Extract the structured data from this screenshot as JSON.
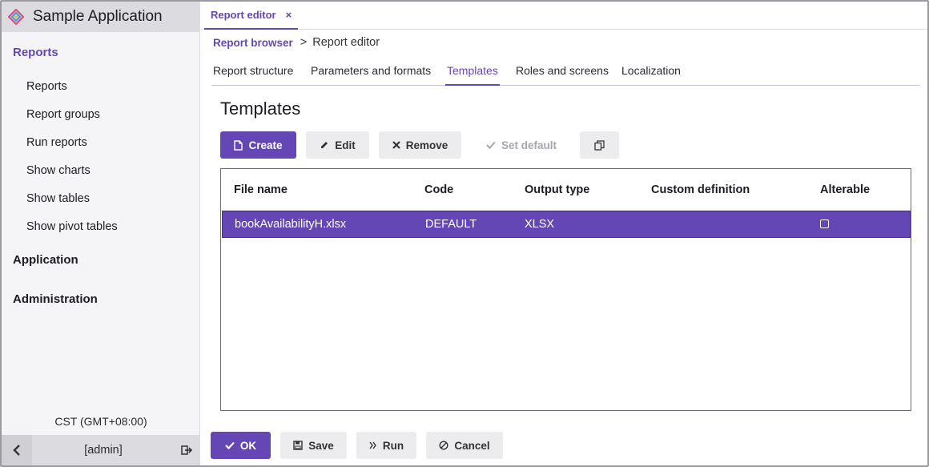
{
  "app": {
    "title": "Sample Application"
  },
  "sidebar": {
    "groups": [
      {
        "label": "Reports"
      },
      {
        "label": "Application"
      },
      {
        "label": "Administration"
      }
    ],
    "items": [
      {
        "label": "Reports"
      },
      {
        "label": "Report groups"
      },
      {
        "label": "Run reports"
      },
      {
        "label": "Show charts"
      },
      {
        "label": "Show tables"
      },
      {
        "label": "Show pivot tables"
      }
    ],
    "timezone": "CST (GMT+08:00)",
    "user": "[admin]"
  },
  "tabbar": {
    "tab_label": "Report editor",
    "close": "×"
  },
  "breadcrumb": {
    "parent": "Report browser",
    "separator": ">",
    "current": "Report editor"
  },
  "subtabs": [
    {
      "label": "Report structure"
    },
    {
      "label": "Parameters and formats"
    },
    {
      "label": "Templates"
    },
    {
      "label": "Roles and screens"
    },
    {
      "label": "Localization"
    }
  ],
  "section": {
    "title": "Templates"
  },
  "toolbar": {
    "create": "Create",
    "edit": "Edit",
    "remove": "Remove",
    "set_default": "Set default"
  },
  "grid": {
    "columns": [
      "File name",
      "Code",
      "Output type",
      "Custom definition",
      "Alterable"
    ],
    "rows": [
      {
        "file_name": "bookAvailabilityH.xlsx",
        "code": "DEFAULT",
        "output_type": "XLSX",
        "custom_definition": "",
        "alterable": false
      }
    ]
  },
  "footer": {
    "ok": "OK",
    "save": "Save",
    "run": "Run",
    "cancel": "Cancel"
  },
  "colors": {
    "accent": "#6447b5",
    "sidebar_bg": "#f5f5f7",
    "header_bg": "#dcdce0"
  },
  "icons": [
    "app-logo-icon",
    "chevron-left-icon",
    "logout-icon",
    "file-icon",
    "pencil-icon",
    "close-icon",
    "check-icon",
    "copy-icon",
    "save-icon",
    "run-icon",
    "cancel-icon"
  ]
}
